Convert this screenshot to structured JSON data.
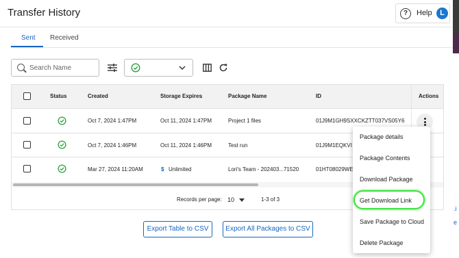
{
  "header": {
    "title": "Transfer History",
    "help_label": "Help",
    "avatar_initial": "L"
  },
  "tabs": [
    {
      "label": "Sent",
      "active": true
    },
    {
      "label": "Received",
      "active": false
    }
  ],
  "toolbar": {
    "search_placeholder": "Search Name",
    "status_filter_icon": "check-circle-icon"
  },
  "table": {
    "columns": [
      "Status",
      "Created",
      "Storage Expires",
      "Package Name",
      "ID",
      "Actions"
    ],
    "sort_indicator": "↓",
    "rows": [
      {
        "status": "complete",
        "created": "Oct 7, 2024 1:47PM",
        "expires": "Oct 11, 2024 1:47PM",
        "name": "Project 1 files",
        "id": "01J9M1GH9SXXCKZTT037VS05Y6"
      },
      {
        "status": "complete",
        "created": "Oct 7, 2024 1:46PM",
        "expires": "Oct 11, 2024 1:46PM",
        "name": "Test run",
        "id": "01J9M1EQKVI"
      },
      {
        "status": "complete",
        "created": "Mar 27, 2024 11:20AM",
        "expires": "Unlimited",
        "expires_icon": "$",
        "name": "Lori's Team - 202403...71520",
        "id": "01HT08029WE"
      }
    ]
  },
  "pagination": {
    "label": "Records per page:",
    "per_page": "10",
    "range": "1-3 of 3"
  },
  "buttons": {
    "export_table": "Export Table to CSV",
    "export_all": "Export All Packages to CSV"
  },
  "menu": {
    "items": [
      "Package details",
      "Package Contents",
      "Download Package",
      "Get Download Link",
      "Save Package to Cloud",
      "Delete Package"
    ],
    "highlighted": "Get Download Link"
  },
  "colors": {
    "accent": "#1565c0",
    "success": "#2e9e3e",
    "highlight": "#3be33b"
  },
  "side": {
    "mark1": ".i",
    "mark2": "e"
  }
}
